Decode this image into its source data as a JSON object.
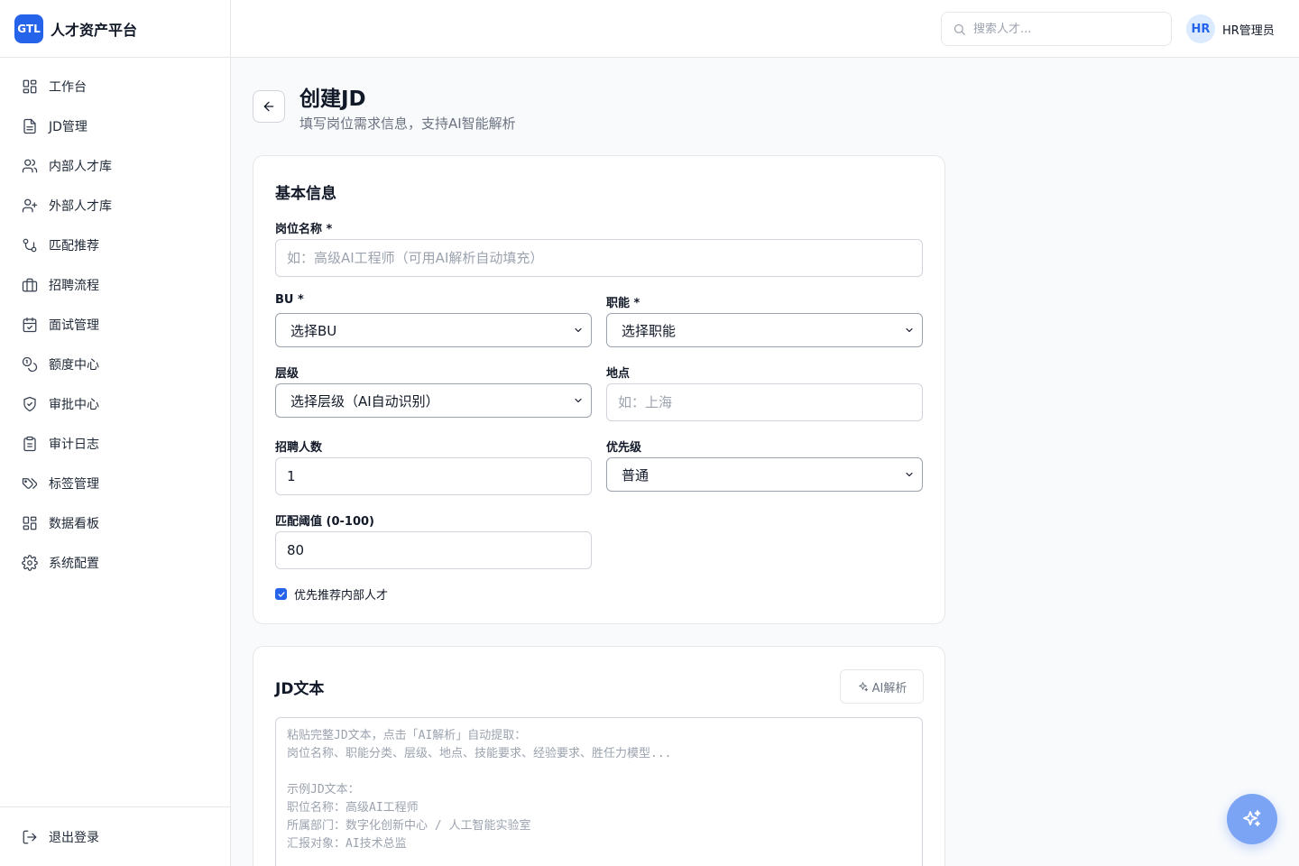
{
  "app": {
    "logo": "GTL",
    "name": "人才资产平台"
  },
  "sidebar": {
    "items": [
      {
        "label": "工作台",
        "icon": "dashboard-icon"
      },
      {
        "label": "JD管理",
        "icon": "document-icon"
      },
      {
        "label": "内部人才库",
        "icon": "users-icon"
      },
      {
        "label": "外部人才库",
        "icon": "user-plus-icon"
      },
      {
        "label": "匹配推荐",
        "icon": "git-branch-icon"
      },
      {
        "label": "招聘流程",
        "icon": "briefcase-icon"
      },
      {
        "label": "面试管理",
        "icon": "calendar-icon"
      },
      {
        "label": "额度中心",
        "icon": "coins-icon"
      },
      {
        "label": "审批中心",
        "icon": "shield-check-icon"
      },
      {
        "label": "审计日志",
        "icon": "clipboard-icon"
      },
      {
        "label": "标签管理",
        "icon": "tags-icon"
      },
      {
        "label": "数据看板",
        "icon": "grid-icon"
      },
      {
        "label": "系统配置",
        "icon": "gear-icon"
      }
    ],
    "logout": {
      "label": "退出登录",
      "icon": "logout-icon"
    }
  },
  "header": {
    "search_placeholder": "搜索人才...",
    "avatar_initials": "HR",
    "user_name": "HR管理员"
  },
  "page": {
    "title": "创建JD",
    "subtitle": "填写岗位需求信息，支持AI智能解析"
  },
  "basic_info": {
    "title": "基本信息",
    "position_name": {
      "label": "岗位名称 *",
      "placeholder": "如：高级AI工程师（可用AI解析自动填充）",
      "value": ""
    },
    "bu": {
      "label": "BU *",
      "selected": "选择BU"
    },
    "function": {
      "label": "职能 *",
      "selected": "选择职能"
    },
    "level": {
      "label": "层级",
      "selected": "选择层级（AI自动识别）"
    },
    "location": {
      "label": "地点",
      "placeholder": "如：上海",
      "value": ""
    },
    "headcount": {
      "label": "招聘人数",
      "value": "1"
    },
    "priority": {
      "label": "优先级",
      "selected": "普通"
    },
    "match_threshold": {
      "label": "匹配阈值 (0-100)",
      "value": "80"
    },
    "prefer_internal": {
      "label": "优先推荐内部人才",
      "checked": true
    }
  },
  "jd_text": {
    "title": "JD文本",
    "ai_button": "AI解析",
    "placeholder": "粘贴完整JD文本，点击「AI解析」自动提取：\n岗位名称、职能分类、层级、地点、技能要求、经验要求、胜任力模型...\n\n示例JD文本：\n职位名称：高级AI工程师\n所属部门：数字化创新中心 / 人工智能实验室\n汇报对象：AI技术总监"
  },
  "colors": {
    "primary": "#2563eb",
    "fab": "#7ba4f5"
  }
}
